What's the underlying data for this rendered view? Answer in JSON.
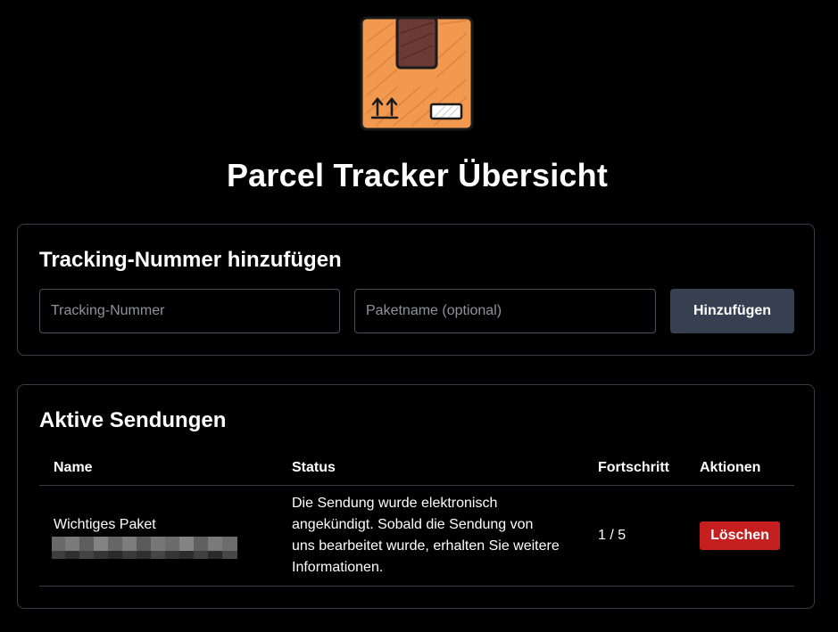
{
  "app": {
    "title": "Parcel Tracker Übersicht",
    "logo": "parcel-box-icon"
  },
  "add_form": {
    "title": "Tracking-Nummer hinzufügen",
    "tracking_placeholder": "Tracking-Nummer",
    "tracking_value": "",
    "name_placeholder": "Paketname (optional)",
    "name_value": "",
    "submit_label": "Hinzufügen"
  },
  "shipments": {
    "title": "Aktive Sendungen",
    "columns": [
      "Name",
      "Status",
      "Fortschritt",
      "Aktionen"
    ],
    "rows": [
      {
        "name": "Wichtiges Paket",
        "tracking_number_redacted": true,
        "status": "Die Sendung wurde elektronisch angekündigt. Sobald die Sendung von uns bearbeitet wurde, erhalten Sie weitere Informationen.",
        "progress": "1 / 5",
        "delete_label": "Löschen"
      }
    ]
  },
  "colors": {
    "background": "#000000",
    "card_border": "#3a3d42",
    "primary_button": "#374050",
    "danger_button": "#c61f1f",
    "box_orange": "#f0994f",
    "box_tape": "#6b3a35"
  }
}
